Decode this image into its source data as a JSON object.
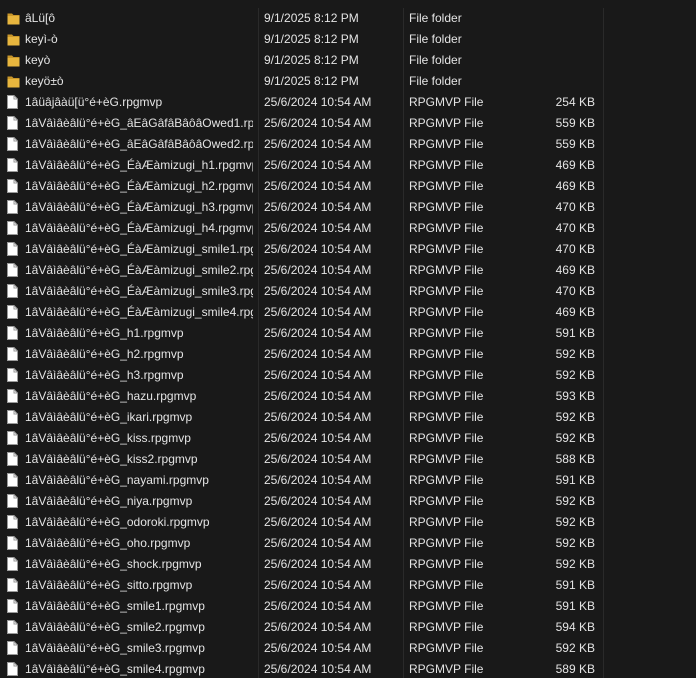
{
  "files": [
    {
      "name": "âLü[ô",
      "date": "9/1/2025 8:12 PM",
      "type": "File folder",
      "size": "",
      "icon": "folder-icon"
    },
    {
      "name": "keyì-ò",
      "date": "9/1/2025 8:12 PM",
      "type": "File folder",
      "size": "",
      "icon": "folder-icon"
    },
    {
      "name": "keyò",
      "date": "9/1/2025 8:12 PM",
      "type": "File folder",
      "size": "",
      "icon": "folder-icon"
    },
    {
      "name": "keyö±ò",
      "date": "9/1/2025 8:12 PM",
      "type": "File folder",
      "size": "",
      "icon": "folder-icon"
    },
    {
      "name": "1âüâjâàü[ü°é+èG.rpgmvp",
      "date": "25/6/2024 10:54 AM",
      "type": "RPGMVP File",
      "size": "254 KB",
      "icon": "file-icon"
    },
    {
      "name": "1âVâìâèâlü°é+èG_âEâGâfâBâôâOwed1.rp...",
      "date": "25/6/2024 10:54 AM",
      "type": "RPGMVP File",
      "size": "559 KB",
      "icon": "file-icon"
    },
    {
      "name": "1âVâìâèâlü°é+èG_âEâGâfâBâôâOwed2.rp...",
      "date": "25/6/2024 10:54 AM",
      "type": "RPGMVP File",
      "size": "559 KB",
      "icon": "file-icon"
    },
    {
      "name": "1âVâìâèâlü°é+èG_ÉàÆàmizugi_h1.rpgmvp",
      "date": "25/6/2024 10:54 AM",
      "type": "RPGMVP File",
      "size": "469 KB",
      "icon": "file-icon"
    },
    {
      "name": "1âVâìâèâlü°é+èG_ÉàÆàmizugi_h2.rpgmvp",
      "date": "25/6/2024 10:54 AM",
      "type": "RPGMVP File",
      "size": "469 KB",
      "icon": "file-icon"
    },
    {
      "name": "1âVâìâèâlü°é+èG_ÉàÆàmizugi_h3.rpgmvp",
      "date": "25/6/2024 10:54 AM",
      "type": "RPGMVP File",
      "size": "470 KB",
      "icon": "file-icon"
    },
    {
      "name": "1âVâìâèâlü°é+èG_ÉàÆàmizugi_h4.rpgmvp",
      "date": "25/6/2024 10:54 AM",
      "type": "RPGMVP File",
      "size": "470 KB",
      "icon": "file-icon"
    },
    {
      "name": "1âVâìâèâlü°é+èG_ÉàÆàmizugi_smile1.rpg...",
      "date": "25/6/2024 10:54 AM",
      "type": "RPGMVP File",
      "size": "470 KB",
      "icon": "file-icon"
    },
    {
      "name": "1âVâìâèâlü°é+èG_ÉàÆàmizugi_smile2.rpg...",
      "date": "25/6/2024 10:54 AM",
      "type": "RPGMVP File",
      "size": "469 KB",
      "icon": "file-icon"
    },
    {
      "name": "1âVâìâèâlü°é+èG_ÉàÆàmizugi_smile3.rpg...",
      "date": "25/6/2024 10:54 AM",
      "type": "RPGMVP File",
      "size": "470 KB",
      "icon": "file-icon"
    },
    {
      "name": "1âVâìâèâlü°é+èG_ÉàÆàmizugi_smile4.rpg...",
      "date": "25/6/2024 10:54 AM",
      "type": "RPGMVP File",
      "size": "469 KB",
      "icon": "file-icon"
    },
    {
      "name": "1âVâìâèâlü°é+èG_h1.rpgmvp",
      "date": "25/6/2024 10:54 AM",
      "type": "RPGMVP File",
      "size": "591 KB",
      "icon": "file-icon"
    },
    {
      "name": "1âVâìâèâlü°é+èG_h2.rpgmvp",
      "date": "25/6/2024 10:54 AM",
      "type": "RPGMVP File",
      "size": "592 KB",
      "icon": "file-icon"
    },
    {
      "name": "1âVâìâèâlü°é+èG_h3.rpgmvp",
      "date": "25/6/2024 10:54 AM",
      "type": "RPGMVP File",
      "size": "592 KB",
      "icon": "file-icon"
    },
    {
      "name": "1âVâìâèâlü°é+èG_hazu.rpgmvp",
      "date": "25/6/2024 10:54 AM",
      "type": "RPGMVP File",
      "size": "593 KB",
      "icon": "file-icon"
    },
    {
      "name": "1âVâìâèâlü°é+èG_ikari.rpgmvp",
      "date": "25/6/2024 10:54 AM",
      "type": "RPGMVP File",
      "size": "592 KB",
      "icon": "file-icon"
    },
    {
      "name": "1âVâìâèâlü°é+èG_kiss.rpgmvp",
      "date": "25/6/2024 10:54 AM",
      "type": "RPGMVP File",
      "size": "592 KB",
      "icon": "file-icon"
    },
    {
      "name": "1âVâìâèâlü°é+èG_kiss2.rpgmvp",
      "date": "25/6/2024 10:54 AM",
      "type": "RPGMVP File",
      "size": "588 KB",
      "icon": "file-icon"
    },
    {
      "name": "1âVâìâèâlü°é+èG_nayami.rpgmvp",
      "date": "25/6/2024 10:54 AM",
      "type": "RPGMVP File",
      "size": "591 KB",
      "icon": "file-icon"
    },
    {
      "name": "1âVâìâèâlü°é+èG_niya.rpgmvp",
      "date": "25/6/2024 10:54 AM",
      "type": "RPGMVP File",
      "size": "592 KB",
      "icon": "file-icon"
    },
    {
      "name": "1âVâìâèâlü°é+èG_odoroki.rpgmvp",
      "date": "25/6/2024 10:54 AM",
      "type": "RPGMVP File",
      "size": "592 KB",
      "icon": "file-icon"
    },
    {
      "name": "1âVâìâèâlü°é+èG_oho.rpgmvp",
      "date": "25/6/2024 10:54 AM",
      "type": "RPGMVP File",
      "size": "592 KB",
      "icon": "file-icon"
    },
    {
      "name": "1âVâìâèâlü°é+èG_shock.rpgmvp",
      "date": "25/6/2024 10:54 AM",
      "type": "RPGMVP File",
      "size": "592 KB",
      "icon": "file-icon"
    },
    {
      "name": "1âVâìâèâlü°é+èG_sitto.rpgmvp",
      "date": "25/6/2024 10:54 AM",
      "type": "RPGMVP File",
      "size": "591 KB",
      "icon": "file-icon"
    },
    {
      "name": "1âVâìâèâlü°é+èG_smile1.rpgmvp",
      "date": "25/6/2024 10:54 AM",
      "type": "RPGMVP File",
      "size": "591 KB",
      "icon": "file-icon"
    },
    {
      "name": "1âVâìâèâlü°é+èG_smile2.rpgmvp",
      "date": "25/6/2024 10:54 AM",
      "type": "RPGMVP File",
      "size": "594 KB",
      "icon": "file-icon"
    },
    {
      "name": "1âVâìâèâlü°é+èG_smile3.rpgmvp",
      "date": "25/6/2024 10:54 AM",
      "type": "RPGMVP File",
      "size": "592 KB",
      "icon": "file-icon"
    },
    {
      "name": "1âVâìâèâlü°é+èG_smile4.rpgmvp",
      "date": "25/6/2024 10:54 AM",
      "type": "RPGMVP File",
      "size": "589 KB",
      "icon": "file-icon"
    }
  ],
  "colors": {
    "background": "#191919",
    "text": "#e4e4e4",
    "folder": "#e8b63e",
    "folder_dark": "#c9972a",
    "file_page": "#ffffff",
    "file_outline": "#9a9a9a"
  }
}
